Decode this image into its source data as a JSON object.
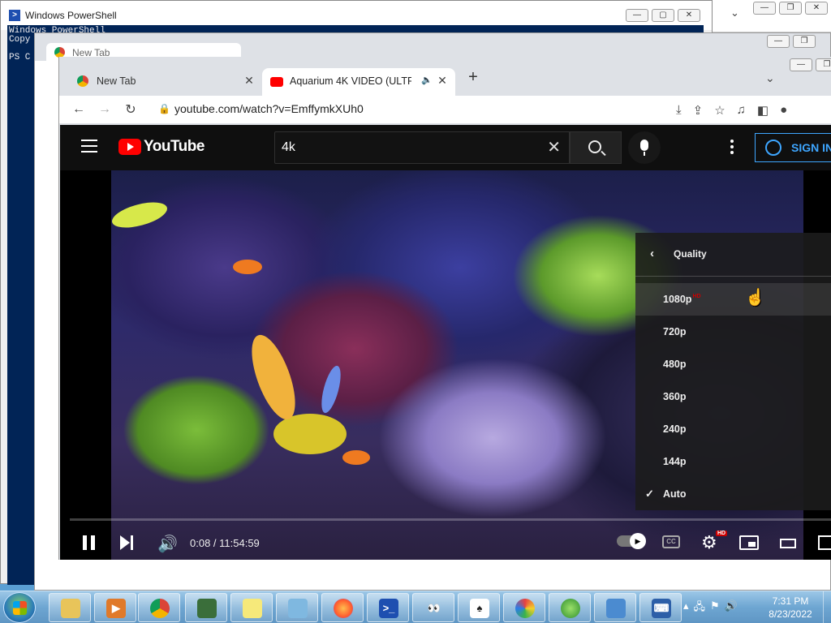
{
  "powershell": {
    "title": "Windows PowerShell",
    "console_lines": [
      "Windows PowerShell",
      "Copy",
      "",
      "PS C"
    ]
  },
  "chrome_back": {
    "tab_label": "New Tab"
  },
  "chrome": {
    "tabs": [
      {
        "label": "New Tab"
      },
      {
        "label": "Aquarium 4K VIDEO (ULTRA"
      }
    ],
    "url": "youtube.com/watch?v=EmffymkXUh0"
  },
  "youtube": {
    "logo_text": "YouTube",
    "search_value": "4k",
    "sign_in_label": "SIGN IN",
    "player": {
      "time": "0:08 / 11:54:59",
      "quality_menu": {
        "title": "Quality",
        "options": [
          {
            "label": "1080p",
            "hd": "HD"
          },
          {
            "label": "720p"
          },
          {
            "label": "480p"
          },
          {
            "label": "360p"
          },
          {
            "label": "240p"
          },
          {
            "label": "144p"
          },
          {
            "label": "Auto",
            "selected": true
          }
        ]
      },
      "settings_badge": "HD"
    }
  },
  "taskbar": {
    "clock_time": "7:31 PM",
    "clock_date": "8/23/2022"
  },
  "colors": {
    "youtube_red": "#ff0000",
    "signin_blue": "#3ea6ff",
    "console_bg": "#012456"
  }
}
